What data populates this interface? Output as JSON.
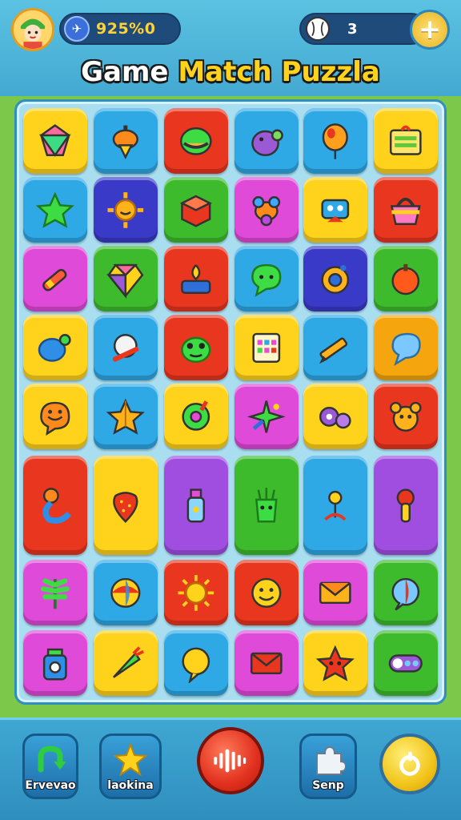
{
  "header": {
    "coins": "925%0",
    "balls": "3",
    "plus_label": "+",
    "title_part1": "Game ",
    "title_part2": "Match Puzzla"
  },
  "colors": {
    "yellow": "#ffd21c",
    "blue": "#2fa8e6",
    "red": "#e8361f",
    "purple": "#a04ee0",
    "green": "#3dbb2c",
    "magenta": "#e04ad8",
    "indigo": "#3a3ac8",
    "orange": "#f5a60f"
  },
  "board": {
    "rows": [
      [
        {
          "color": "yellow",
          "icon": "gem-icon"
        },
        {
          "color": "blue",
          "icon": "spinning-top-icon"
        },
        {
          "color": "red",
          "icon": "green-blob-icon"
        },
        {
          "color": "blue",
          "icon": "purple-creature-icon"
        },
        {
          "color": "blue",
          "icon": "balloon-icon"
        },
        {
          "color": "yellow",
          "icon": "gift-card-icon"
        }
      ],
      [
        {
          "color": "blue",
          "icon": "star-icon"
        },
        {
          "color": "indigo",
          "icon": "sun-icon"
        },
        {
          "color": "green",
          "icon": "cube-icon"
        },
        {
          "color": "magenta",
          "icon": "bug-icon"
        },
        {
          "color": "yellow",
          "icon": "robot-icon"
        },
        {
          "color": "red",
          "icon": "basket-icon"
        }
      ],
      [
        {
          "color": "magenta",
          "icon": "crayon-icon"
        },
        {
          "color": "green",
          "icon": "diamond-icon"
        },
        {
          "color": "red",
          "icon": "cake-icon"
        },
        {
          "color": "blue",
          "icon": "leaf-chat-icon"
        },
        {
          "color": "indigo",
          "icon": "orange-ring-icon"
        },
        {
          "color": "green",
          "icon": "apple-icon"
        }
      ],
      [
        {
          "color": "yellow",
          "icon": "blue-bird-icon"
        },
        {
          "color": "blue",
          "icon": "wand-icon"
        },
        {
          "color": "red",
          "icon": "frog-icon"
        },
        {
          "color": "yellow",
          "icon": "calculator-icon"
        },
        {
          "color": "blue",
          "icon": "pencil-icon"
        },
        {
          "color": "orange",
          "icon": "speech-bubble-icon"
        }
      ],
      [
        {
          "color": "yellow",
          "icon": "smile-bubble-icon"
        },
        {
          "color": "blue",
          "icon": "paper-star-icon"
        },
        {
          "color": "yellow",
          "icon": "donut-icon"
        },
        {
          "color": "magenta",
          "icon": "sparkle-icon"
        },
        {
          "color": "yellow",
          "icon": "bubbles-icon"
        },
        {
          "color": "red",
          "icon": "teddy-icon"
        }
      ],
      [
        {
          "color": "red",
          "icon": "swan-icon"
        },
        {
          "color": "yellow",
          "icon": "strawberry-icon"
        },
        {
          "color": "purple",
          "icon": "bottle-icon"
        },
        {
          "color": "green",
          "icon": "cactus-icon"
        },
        {
          "color": "blue",
          "icon": "flower-icon"
        },
        {
          "color": "purple",
          "icon": "lollipop-icon"
        }
      ],
      [
        {
          "color": "magenta",
          "icon": "fern-icon"
        },
        {
          "color": "blue",
          "icon": "beach-ball-icon"
        },
        {
          "color": "red",
          "icon": "sunburst-icon"
        },
        {
          "color": "red",
          "icon": "smiley-icon"
        },
        {
          "color": "magenta",
          "icon": "envelope-icon"
        },
        {
          "color": "green",
          "icon": "striped-bubble-icon"
        }
      ],
      [
        {
          "color": "magenta",
          "icon": "jar-icon"
        },
        {
          "color": "yellow",
          "icon": "carrot-icon"
        },
        {
          "color": "blue",
          "icon": "yellow-bubble-icon"
        },
        {
          "color": "magenta",
          "icon": "mail-icon"
        },
        {
          "color": "yellow",
          "icon": "starfish-icon"
        },
        {
          "color": "green",
          "icon": "toggle-icon"
        }
      ]
    ]
  },
  "footer": {
    "btn1_label": "Ervevao",
    "btn2_label": "laokina",
    "btn3_label": "Senp"
  }
}
